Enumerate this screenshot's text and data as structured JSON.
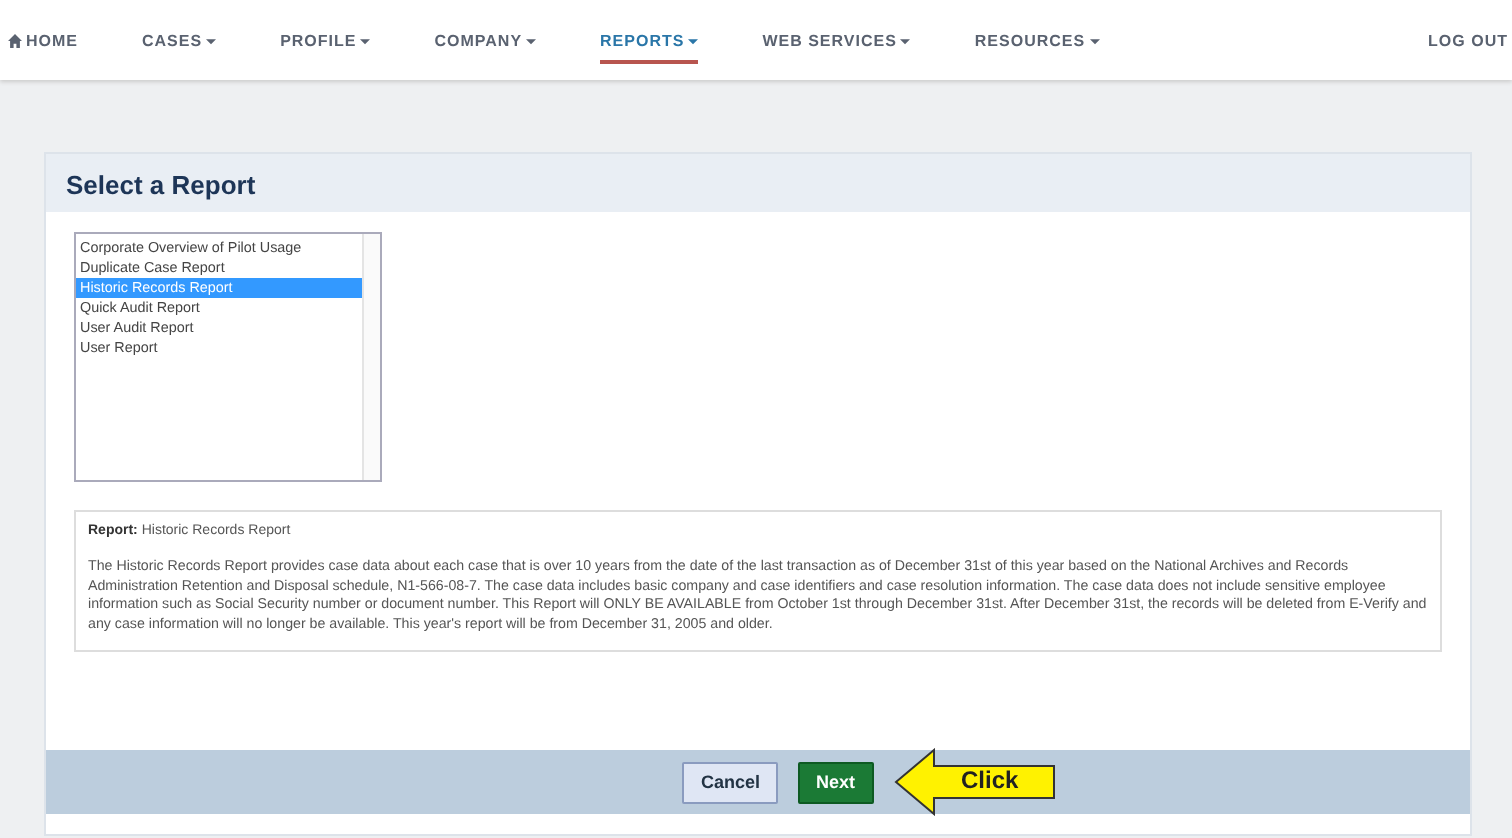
{
  "nav": {
    "items": [
      {
        "label": "HOME",
        "kind": "home",
        "selected": false
      },
      {
        "label": "CASES",
        "kind": "menu",
        "selected": false
      },
      {
        "label": "PROFILE",
        "kind": "menu",
        "selected": false
      },
      {
        "label": "COMPANY",
        "kind": "menu",
        "selected": false
      },
      {
        "label": "REPORTS",
        "kind": "menu",
        "selected": true
      },
      {
        "label": "WEB SERVICES",
        "kind": "menu",
        "selected": false
      },
      {
        "label": "RESOURCES",
        "kind": "menu",
        "selected": false
      }
    ],
    "logout": "LOG OUT"
  },
  "panel": {
    "title": "Select a Report",
    "reports": [
      {
        "label": "Corporate Overview of Pilot Usage",
        "selected": false
      },
      {
        "label": "Duplicate Case Report",
        "selected": false
      },
      {
        "label": "Historic Records Report",
        "selected": true
      },
      {
        "label": "Quick Audit Report",
        "selected": false
      },
      {
        "label": "User Audit Report",
        "selected": false
      },
      {
        "label": "User Report",
        "selected": false
      }
    ],
    "description": {
      "label": "Report:",
      "name": "Historic Records Report",
      "text": "The Historic Records Report provides case data about each case that is over 10 years from the date of the last transaction as of December 31st of this year based on the National Archives and Records Administration Retention and Disposal schedule, N1-566-08-7. The case data includes basic company and case identifiers and case resolution information. The case data does not include sensitive employee information such as Social Security number or document number. This Report will ONLY BE AVAILABLE from October 1st through December 31st. After December 31st, the records will be deleted from E-Verify and any case information will no longer be available. This year's report will be from December 31, 2005 and older."
    },
    "buttons": [
      {
        "label": "Cancel",
        "kind": "secondary"
      },
      {
        "label": "Next",
        "kind": "primary"
      }
    ],
    "callout": "Click"
  }
}
